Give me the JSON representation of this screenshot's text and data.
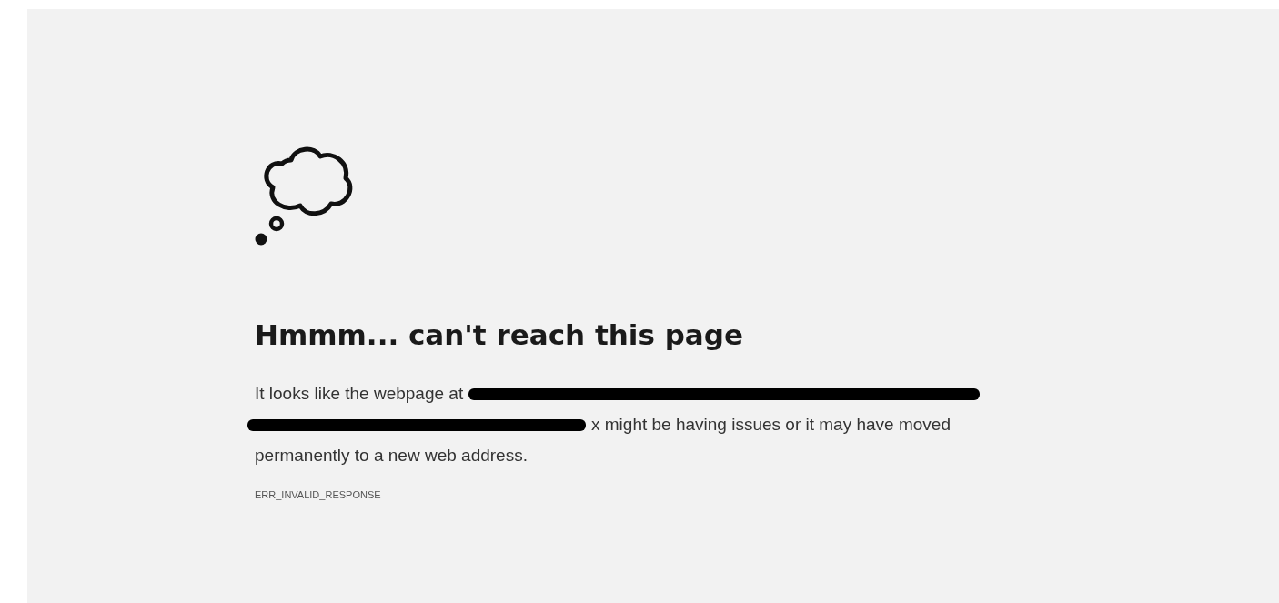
{
  "heading": "Hmmm... can't reach this page",
  "message_lines": [
    [
      {
        "kind": "text",
        "text": "It looks like the webpage at"
      },
      {
        "kind": "redacted"
      }
    ],
    [
      {
        "kind": "redacted"
      },
      {
        "kind": "text",
        "text": "x might be having issues or it may have moved"
      }
    ],
    [
      {
        "kind": "text",
        "text": "permanently to a new web address."
      }
    ]
  ],
  "error_code": "ERR_INVALID_RESPONSE"
}
